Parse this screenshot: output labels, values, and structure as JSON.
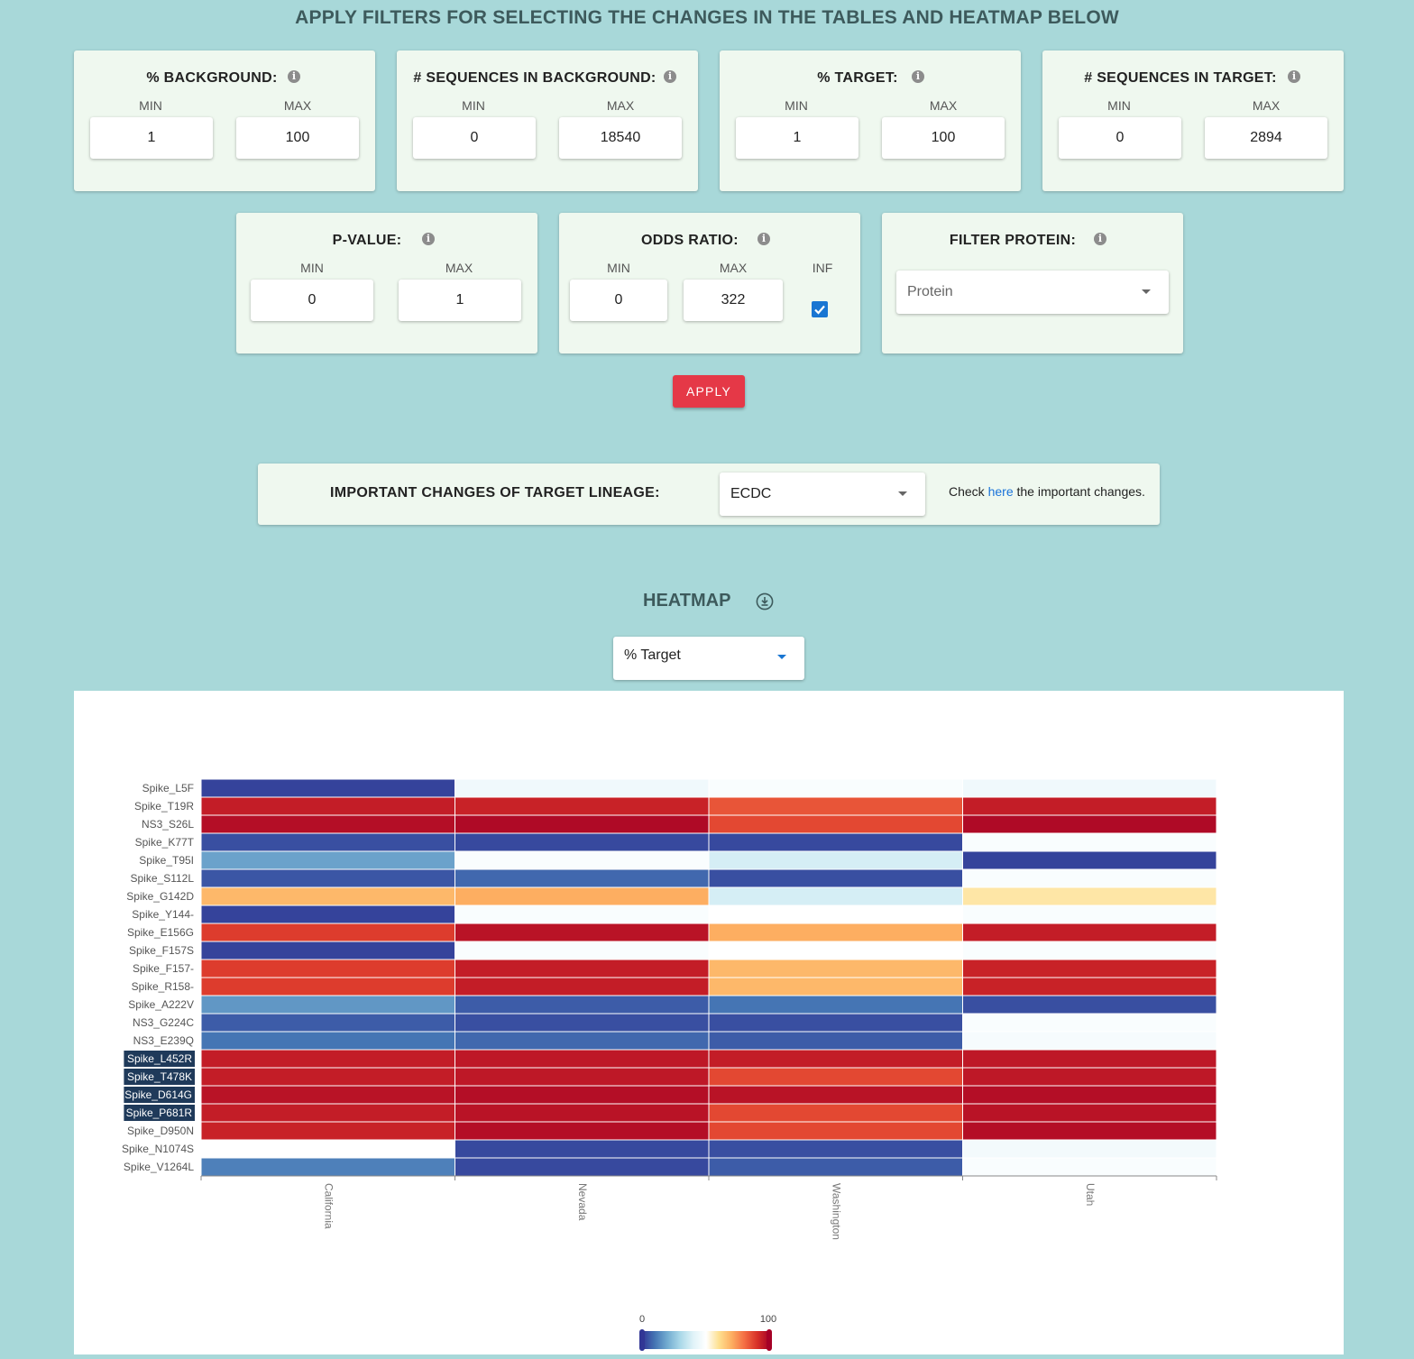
{
  "page_title": "APPLY FILTERS FOR SELECTING THE CHANGES IN THE TABLES AND HEATMAP BELOW",
  "labels": {
    "min": "MIN",
    "max": "MAX",
    "inf": "INF"
  },
  "filters": {
    "background_pct": {
      "title": "% BACKGROUND:",
      "min": "1",
      "max": "100"
    },
    "background_seqs": {
      "title": "# SEQUENCES IN BACKGROUND:",
      "min": "0",
      "max": "18540"
    },
    "target_pct": {
      "title": "% TARGET:",
      "min": "1",
      "max": "100"
    },
    "target_seqs": {
      "title": "# SEQUENCES IN TARGET:",
      "min": "0",
      "max": "2894"
    },
    "p_value": {
      "title": "P-VALUE:",
      "min": "0",
      "max": "1"
    },
    "odds_ratio": {
      "title": "ODDS RATIO:",
      "min": "0",
      "max": "322",
      "inf_checked": true
    },
    "protein": {
      "title": "FILTER PROTEIN:",
      "placeholder": "Protein"
    }
  },
  "apply_label": "APPLY",
  "important": {
    "title": "IMPORTANT CHANGES OF TARGET LINEAGE:",
    "selected": "ECDC",
    "note_before": "Check ",
    "note_link": "here",
    "note_after": " the important changes."
  },
  "heatmap": {
    "title": "HEATMAP",
    "metric_selected": "% Target"
  },
  "colors": {
    "accent_button": "#e53847",
    "checkbox": "#1976d2",
    "highlight_label_bg": "#1f3a5a"
  },
  "chart_data": {
    "type": "heatmap",
    "x": [
      "California",
      "Nevada",
      "Washington",
      "Utah"
    ],
    "y": [
      "Spike_L5F",
      "Spike_T19R",
      "NS3_S26L",
      "Spike_K77T",
      "Spike_T95I",
      "Spike_S112L",
      "Spike_G142D",
      "Spike_Y144-",
      "Spike_E156G",
      "Spike_F157S",
      "Spike_F157-",
      "Spike_R158-",
      "Spike_A222V",
      "NS3_G224C",
      "NS3_E239Q",
      "Spike_L452R",
      "Spike_T478K",
      "Spike_D614G",
      "Spike_P681R",
      "Spike_D950N",
      "Spike_N1074S",
      "Spike_V1264L"
    ],
    "highlighted_rows": [
      "Spike_L452R",
      "Spike_T478K",
      "Spike_D614G",
      "Spike_P681R"
    ],
    "values": [
      [
        2,
        45,
        48,
        45
      ],
      [
        94,
        93,
        84,
        94
      ],
      [
        97,
        98,
        86,
        98
      ],
      [
        4,
        3,
        3,
        48
      ],
      [
        18,
        48,
        38,
        2
      ],
      [
        5,
        8,
        4,
        48
      ],
      [
        68,
        70,
        38,
        58
      ],
      [
        2,
        48,
        50,
        48
      ],
      [
        88,
        96,
        70,
        94
      ],
      [
        2,
        48,
        50,
        48
      ],
      [
        88,
        94,
        68,
        93
      ],
      [
        88,
        94,
        68,
        93
      ],
      [
        16,
        6,
        10,
        4
      ],
      [
        6,
        4,
        4,
        48
      ],
      [
        10,
        8,
        6,
        47
      ],
      [
        94,
        95,
        94,
        95
      ],
      [
        94,
        95,
        86,
        95
      ],
      [
        96,
        97,
        96,
        97
      ],
      [
        94,
        96,
        86,
        96
      ],
      [
        93,
        97,
        86,
        97
      ],
      [
        50,
        3,
        4,
        46
      ],
      [
        12,
        3,
        6,
        48
      ]
    ],
    "zrange": [
      0,
      100
    ],
    "colorbar": {
      "min_label": "0",
      "max_label": "100"
    },
    "colorscale": "RdYlBu reversed"
  }
}
